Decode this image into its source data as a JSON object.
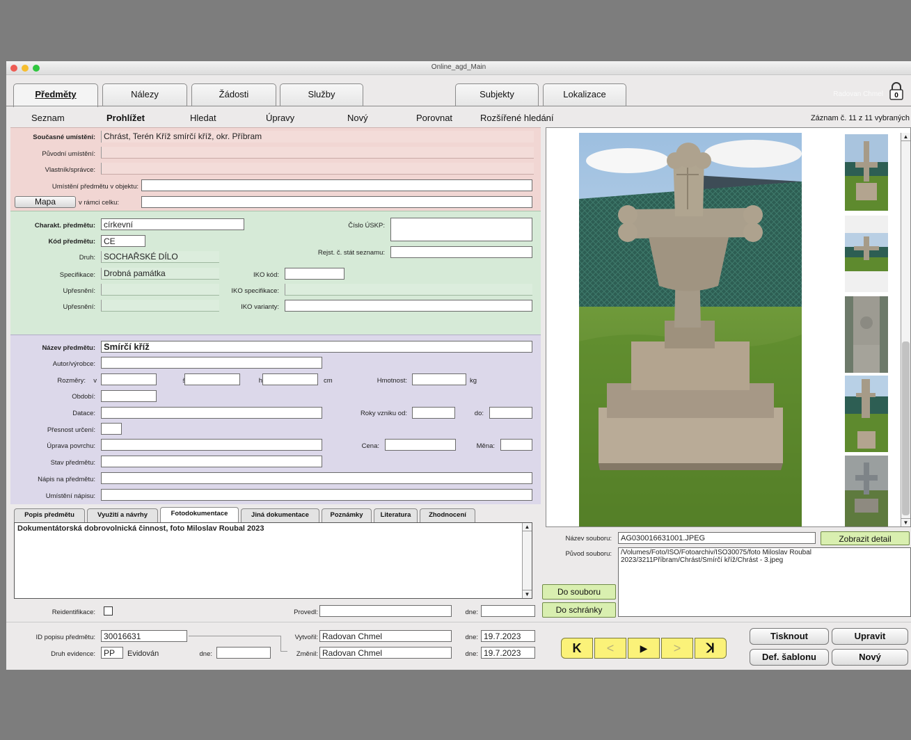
{
  "window": {
    "title": "Online_agd_Main"
  },
  "tabs": [
    {
      "label": "Předměty",
      "active": true
    },
    {
      "label": "Nálezy"
    },
    {
      "label": "Žádosti"
    },
    {
      "label": "Služby"
    },
    {
      "label": "Subjekty"
    },
    {
      "label": "Lokalizace"
    }
  ],
  "user": {
    "name": "Radovan Chmel",
    "lock_count": "0"
  },
  "subnav": {
    "items": [
      "Seznam",
      "Prohlížet",
      "Hledat",
      "Úpravy",
      "Nový",
      "Porovnat",
      "Rozšířené hledání"
    ],
    "active": "Prohlížet",
    "record_status": "Záznam č. 11 z 11 vybraných"
  },
  "location": {
    "current_label": "Současné umístění:",
    "current_value": "Chrást, Terén Kříž smírčí kříž, okr. Příbram",
    "original_label": "Původní umístění:",
    "owner_label": "Vlastník/správce:",
    "in_object_label": "Umístění předmětu v objektu:",
    "map_button": "Mapa",
    "in_whole_label": "v rámci celku:"
  },
  "classification": {
    "char_label": "Charakt. předmětu:",
    "char_value": "církevní",
    "code_label": "Kód předmětu:",
    "code_value": "CE",
    "kind_label": "Druh:",
    "kind_value": "SOCHAŘSKÉ DÍLO",
    "spec_label": "Specifikace:",
    "spec_value": "Drobná památka",
    "refine1_label": "Upřesnění:",
    "refine2_label": "Upřesnění:",
    "uskp_label": "Číslo ÚSKP:",
    "reg_label": "Rejst. č. stát seznamu:",
    "iko_code_label": "IKO kód:",
    "iko_spec_label": "IKO specifikace:",
    "iko_var_label": "IKO varianty:"
  },
  "object": {
    "name_label": "Název předmětu:",
    "name_value": "Smírčí kříž",
    "author_label": "Autor/výrobce:",
    "dims_label": "Rozměry:",
    "dim_v": "v",
    "dim_s": "š",
    "dim_h": "h",
    "dim_unit": "cm",
    "weight_label": "Hmotnost:",
    "weight_unit": "kg",
    "period_label": "Období:",
    "dating_label": "Datace:",
    "years_from_label": "Roky vzniku od:",
    "years_to_label": "do:",
    "precision_label": "Přesnost určení:",
    "surface_label": "Úprava povrchu:",
    "price_label": "Cena:",
    "currency_label": "Měna:",
    "state_label": "Stav předmětu:",
    "inscription_label": "Nápis na předmětu:",
    "inscription_place_label": "Umístění nápisu:"
  },
  "subtabs": [
    {
      "label": "Popis předmětu"
    },
    {
      "label": "Využití a návrhy"
    },
    {
      "label": "Fotodokumentace",
      "active": true
    },
    {
      "label": "Jiná dokumentace"
    },
    {
      "label": "Poznámky"
    },
    {
      "label": "Literatura"
    },
    {
      "label": "Zhodnocení"
    }
  ],
  "note": {
    "text": "Dokumentátorská dobrovolnická činnost, foto Miloslav Roubal 2023"
  },
  "reident": {
    "label": "Reidentifikace:",
    "performed_label": "Provedl:",
    "date_label": "dne:"
  },
  "footer": {
    "id_label": "ID popisu předmětu:",
    "id_value": "30016631",
    "evidence_label": "Druh evidence:",
    "evidence_code": "PP",
    "evidence_text": "Evidován",
    "evidence_date_label": "dne:",
    "created_label": "Vytvořil:",
    "created_by": "Radovan Chmel",
    "created_date_label": "dne:",
    "created_date": "19.7.2023",
    "changed_label": "Změnil:",
    "changed_by": "Radovan Chmel",
    "changed_date_label": "dne:",
    "changed_date": "19.7.2023"
  },
  "photo": {
    "filename_label": "Název souboru:",
    "filename": "AG030016631001.JPEG",
    "detail_button": "Zobrazit detail",
    "origin_label": "Původ souboru:",
    "origin": "/Volumes/Foto/ISO/Fotoarchiv/ISO30075/foto Miloslav Roubal 2023/3211Příbram/Chrást/Smírčí kříž/Chrást - 3.jpeg",
    "to_file_button": "Do souboru",
    "to_clipboard_button": "Do schránky"
  },
  "navigation": {
    "first": "K",
    "prev": "<",
    "play": "▶",
    "next": ">",
    "last": "ꓘ"
  },
  "actions": {
    "print": "Tisknout",
    "edit": "Upravit",
    "template": "Def. šablonu",
    "new": "Nový"
  }
}
